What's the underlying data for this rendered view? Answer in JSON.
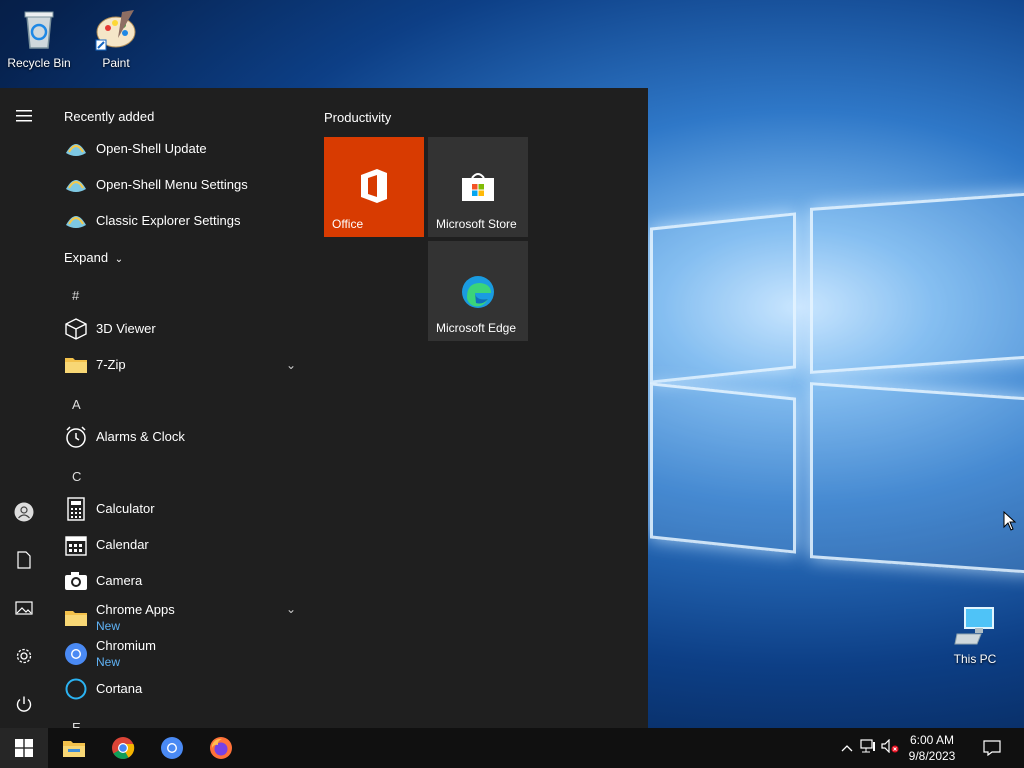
{
  "desktop": {
    "icons": [
      {
        "label": "Recycle Bin",
        "icon": "recycle-bin-icon"
      },
      {
        "label": "Paint",
        "icon": "paint-icon"
      },
      {
        "label": "This PC",
        "icon": "computer-icon"
      }
    ]
  },
  "start_menu": {
    "recently_added_title": "Recently added",
    "recent": [
      {
        "label": "Open-Shell Update"
      },
      {
        "label": "Open-Shell Menu Settings"
      },
      {
        "label": "Classic Explorer Settings"
      }
    ],
    "expand_label": "Expand",
    "sections": {
      "hash": "#",
      "a": "A",
      "c": "C",
      "e": "E"
    },
    "apps": [
      {
        "label": "3D Viewer"
      },
      {
        "label": "7-Zip"
      },
      {
        "label": "Alarms & Clock"
      },
      {
        "label": "Calculator"
      },
      {
        "label": "Calendar"
      },
      {
        "label": "Camera"
      },
      {
        "label": "Chrome Apps",
        "badge": "New"
      },
      {
        "label": "Chromium",
        "badge": "New"
      },
      {
        "label": "Cortana"
      }
    ],
    "tiles_group": "Productivity",
    "tiles": [
      {
        "label": "Office",
        "color": "#d83b01"
      },
      {
        "label": "Microsoft Store",
        "color": "#333333"
      },
      {
        "label": "Microsoft Edge",
        "color": "#333333"
      }
    ]
  },
  "taskbar": {
    "time": "6:00 AM",
    "date": "9/8/2023",
    "accent": "#0078d7"
  }
}
